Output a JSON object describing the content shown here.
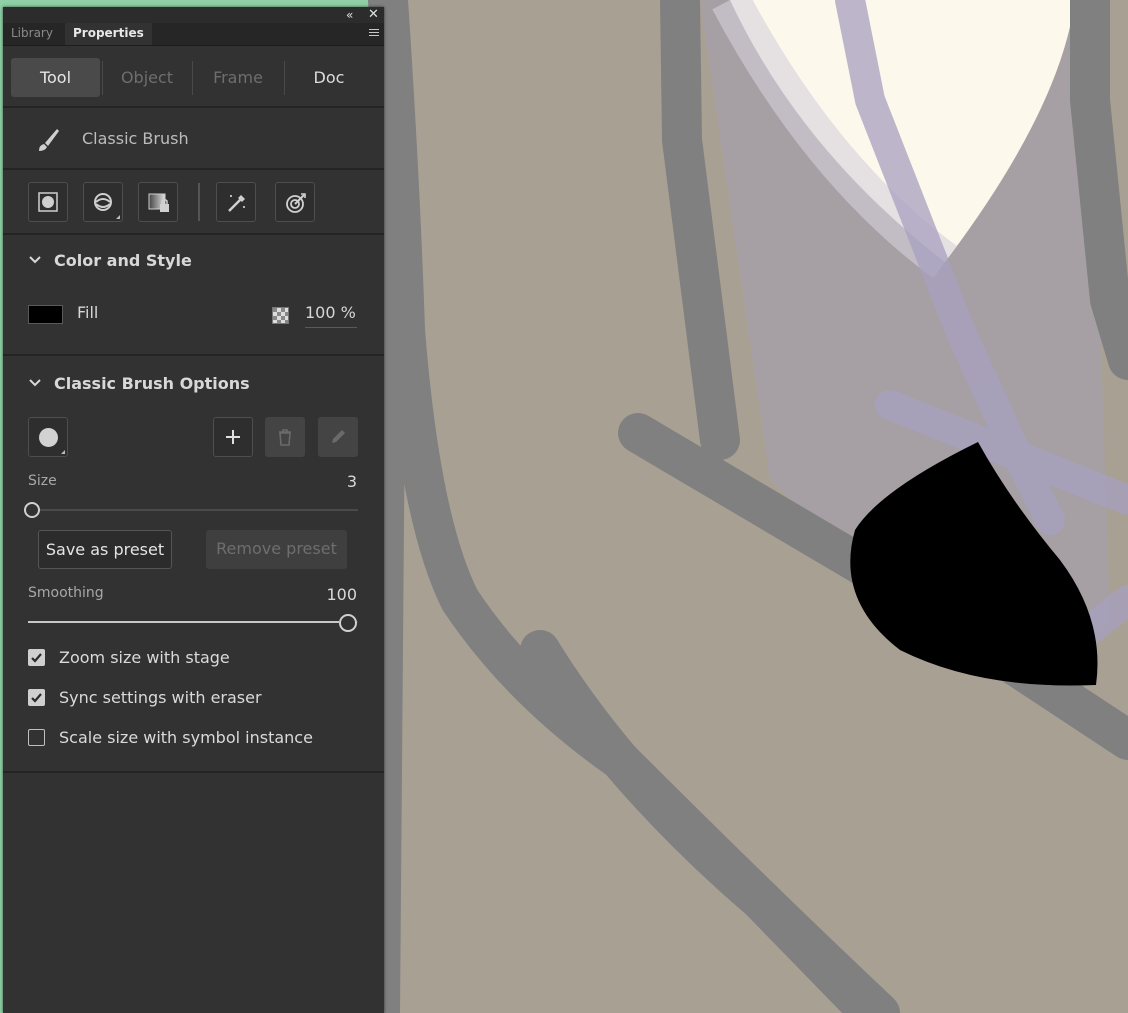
{
  "panel": {
    "collapse_glyph": "«",
    "close_glyph": "✕",
    "tabs": [
      {
        "label": "Library",
        "active": false
      },
      {
        "label": "Properties",
        "active": true
      }
    ],
    "segments": {
      "tool": "Tool",
      "object": "Object",
      "frame": "Frame",
      "doc": "Doc",
      "active": "Tool"
    },
    "tool_name": "Classic Brush",
    "tool_icons": [
      "brush-mode-icon",
      "brush-sync-icon",
      "lock-fill-icon",
      "pressure-pen-icon",
      "tilt-target-icon"
    ]
  },
  "color_style": {
    "heading": "Color and Style",
    "fill_label": "Fill",
    "fill_color": "#000000",
    "alpha_value": "100 %"
  },
  "brush_options": {
    "heading": "Classic Brush Options",
    "size_label": "Size",
    "size_value": "3",
    "size_fraction": 0.0,
    "save_preset": "Save as preset",
    "remove_preset": "Remove preset",
    "smoothing_label": "Smoothing",
    "smoothing_value": "100",
    "smoothing_fraction": 1.0,
    "checkboxes": [
      {
        "label": "Zoom size with stage",
        "checked": true
      },
      {
        "label": "Sync settings with eraser",
        "checked": true
      },
      {
        "label": "Scale size with symbol instance",
        "checked": false
      }
    ]
  },
  "colors": {
    "panel_bg": "#323232",
    "stage_bg": "#a9a094",
    "stroke_gray": "#808080",
    "lavender": "#a7a0bf",
    "cream": "#fdf8ec"
  }
}
